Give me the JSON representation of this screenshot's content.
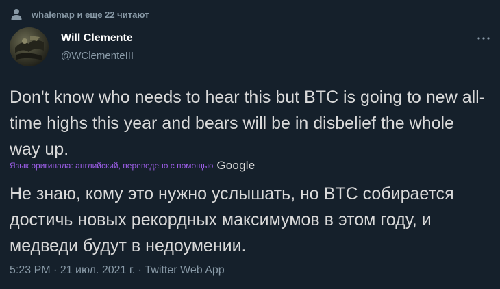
{
  "social_context": {
    "text": "whalemap и еще 22 читают"
  },
  "author": {
    "display_name": "Will Clemente",
    "handle": "@WClementeIII"
  },
  "tweet": {
    "text": "Don't know who needs to hear this but BTC is going to new all-time highs this year and bears will be in disbelief the whole way up.",
    "translation_attribution": "Язык оригинала: английский, переведено с помощью",
    "translation_provider": "Google",
    "translated_text": "Не знаю, кому это нужно услышать, но BTC собирается достичь новых рекордных максимумов в этом году, и медведи будут в недоумении."
  },
  "meta": {
    "time": "5:23 PM",
    "separator": " · ",
    "date": "21 июл. 2021 г.",
    "source": "Twitter Web App"
  },
  "colors": {
    "background": "#15202b",
    "text": "#d9d9d9",
    "secondary_text": "#8899a6",
    "translation_link": "#9b5de5"
  }
}
